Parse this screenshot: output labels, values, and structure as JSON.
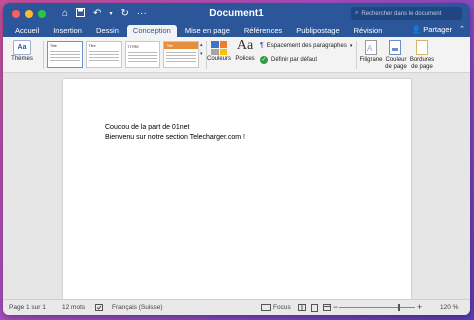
{
  "window": {
    "title": "Document1",
    "search_placeholder": "Rechercher dans le document",
    "share_label": "Partager"
  },
  "tabs": [
    {
      "label": "Accueil",
      "active": false
    },
    {
      "label": "Insertion",
      "active": false
    },
    {
      "label": "Dessin",
      "active": false
    },
    {
      "label": "Conception",
      "active": true
    },
    {
      "label": "Mise en page",
      "active": false
    },
    {
      "label": "Références",
      "active": false
    },
    {
      "label": "Publipostage",
      "active": false
    },
    {
      "label": "Révision",
      "active": false
    }
  ],
  "ribbon": {
    "themes_label": "Thèmes",
    "gallery_titles": [
      "Titre",
      "Titre",
      "TITRE",
      "Titre"
    ],
    "couleurs_label": "Couleurs",
    "polices_label": "Polices",
    "espacement_label": "Espacement des paragraphes",
    "definir_label": "Définir par défaut",
    "filigrane_label": "Filigrane",
    "couleur_page_label": "Couleur\nde page",
    "couleur_page_l1": "Couleur",
    "couleur_page_l2": "de page",
    "bordures_l1": "Bordures",
    "bordures_l2": "de page"
  },
  "document": {
    "line1": "Coucou de la part de 01net",
    "line2": "Bienvenu sur notre section Telecharger.com !"
  },
  "status": {
    "page": "Page 1 sur 1",
    "words": "12 mots",
    "language": "Français (Suisse)",
    "focus": "Focus",
    "zoom": "120 %"
  },
  "colors": {
    "accent": "#2b579a",
    "search_bg": "#1f4680"
  }
}
